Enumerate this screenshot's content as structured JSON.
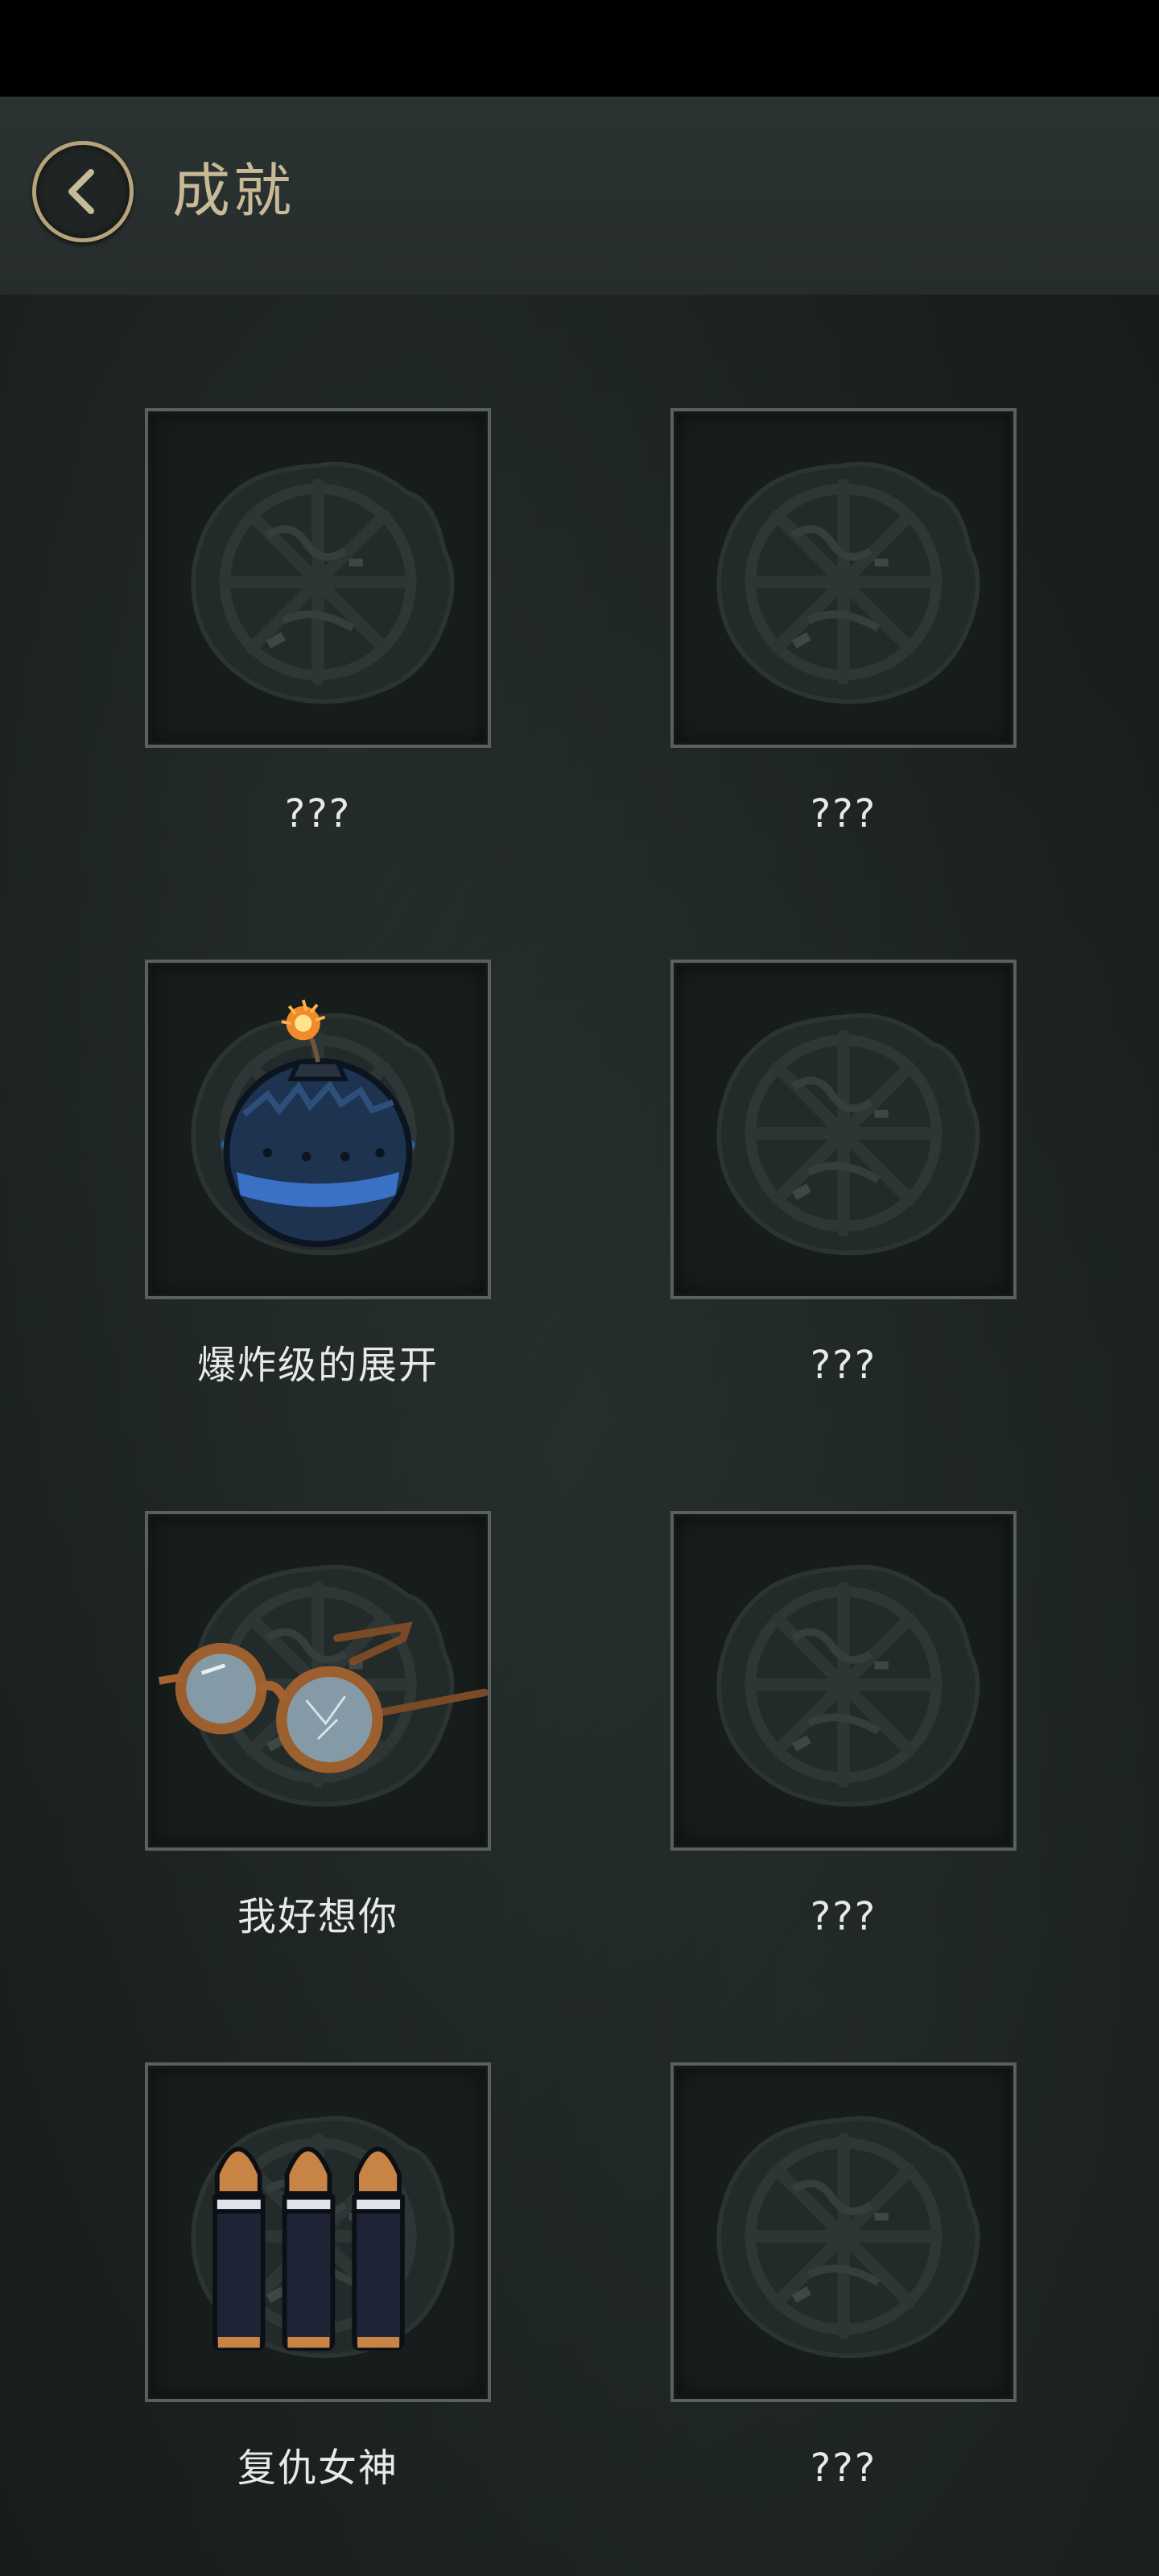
{
  "header": {
    "title": "成就"
  },
  "achievements": [
    {
      "label": "???",
      "icon": "locked-emblem-icon"
    },
    {
      "label": "???",
      "icon": "locked-emblem-icon"
    },
    {
      "label": "爆炸级的展开",
      "icon": "bomb-icon"
    },
    {
      "label": "???",
      "icon": "locked-emblem-icon"
    },
    {
      "label": "我好想你",
      "icon": "glasses-icon"
    },
    {
      "label": "???",
      "icon": "locked-emblem-icon"
    },
    {
      "label": "复仇女神",
      "icon": "bullets-icon"
    },
    {
      "label": "???",
      "icon": "locked-emblem-icon"
    }
  ],
  "colors": {
    "accent": "#b7a37a",
    "title": "#c8b997",
    "background": "#1b2020",
    "card_border": "#59605e"
  }
}
